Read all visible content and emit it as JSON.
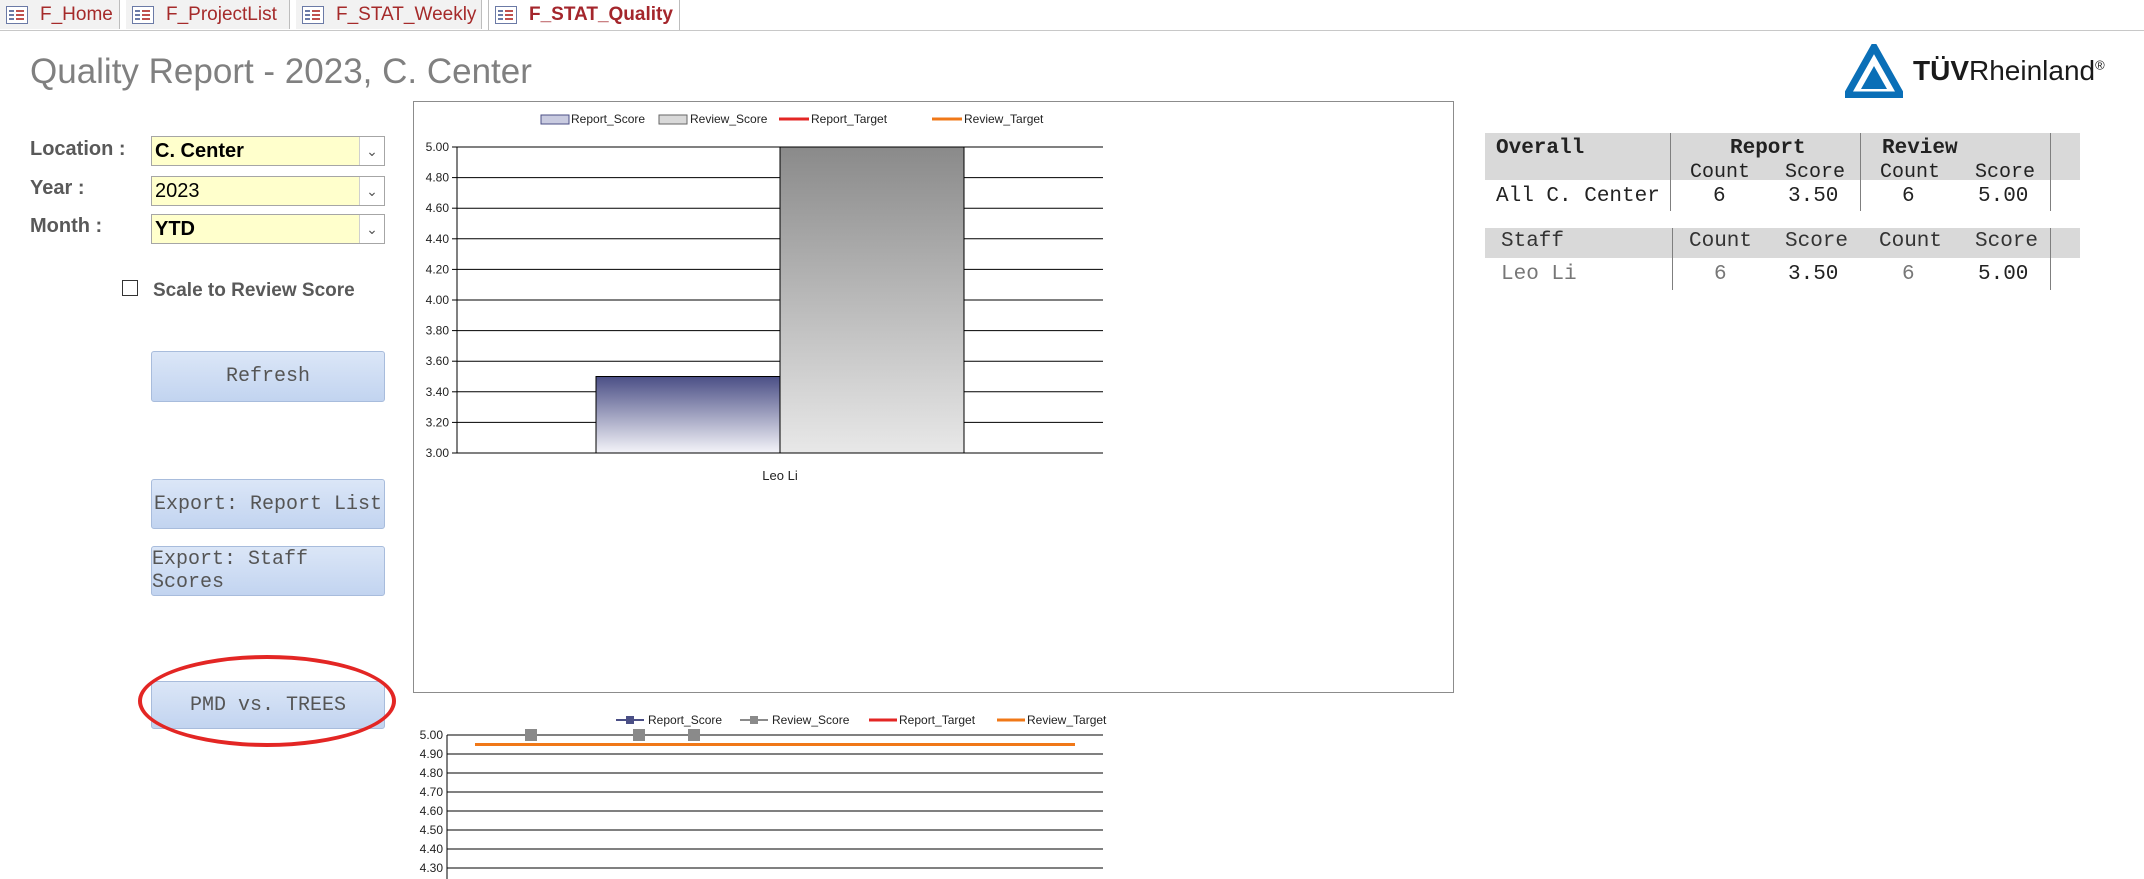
{
  "tabs": [
    {
      "label": "F_Home"
    },
    {
      "label": "F_ProjectList"
    },
    {
      "label": "F_STAT_Weekly"
    },
    {
      "label": "F_STAT_Quality",
      "active": true
    }
  ],
  "title": "Quality Report -  2023, C. Center",
  "logo": {
    "text_bold": "TÜV",
    "text_rest": "Rheinland",
    "reg": "®"
  },
  "filters": {
    "location": {
      "label": "Location :",
      "value": "C. Center"
    },
    "year": {
      "label": "Year :",
      "value": "2023"
    },
    "month": {
      "label": "Month :",
      "value": "YTD"
    }
  },
  "checkbox": {
    "label": "Scale to Review Score",
    "checked": false
  },
  "buttons": {
    "refresh": "Refresh",
    "export_report": "Export: Report List",
    "export_staff": "Export: Staff Scores",
    "pmd": "PMD vs. TREES"
  },
  "colors": {
    "report_score": "#4b4f86",
    "review_score": "#8a8a8a",
    "report_target": "#e32624",
    "review_target": "#f07818",
    "highlight": "#e32624"
  },
  "chart_data": [
    {
      "type": "bar",
      "categories": [
        "Leo Li"
      ],
      "series": [
        {
          "name": "Report_Score",
          "values": [
            3.5
          ]
        },
        {
          "name": "Review_Score",
          "values": [
            5.0
          ]
        }
      ],
      "legend": [
        "Report_Score",
        "Review_Score",
        "Report_Target",
        "Review_Target"
      ],
      "ylim": [
        3.0,
        5.0
      ],
      "yticks": [
        "5.00",
        "4.80",
        "4.60",
        "4.40",
        "4.20",
        "4.00",
        "3.80",
        "3.60",
        "3.40",
        "3.20",
        "3.00"
      ],
      "grid": true
    },
    {
      "type": "line",
      "legend": [
        "Report_Score",
        "Review_Score",
        "Report_Target",
        "Review_Target"
      ],
      "series": [
        {
          "name": "Review_Score",
          "values": [
            5.0,
            5.0,
            5.0
          ]
        },
        {
          "name": "Review_Target",
          "values": [
            4.95
          ]
        }
      ],
      "ylim": [
        4.3,
        5.0
      ],
      "yticks": [
        "5.00",
        "4.90",
        "4.80",
        "4.70",
        "4.60",
        "4.50",
        "4.40",
        "4.30"
      ],
      "grid": true
    }
  ],
  "overall_table": {
    "headers": {
      "col1": "Overall",
      "report": "Report",
      "review": "Review",
      "count": "Count",
      "score": "Score"
    },
    "row": {
      "name": "All C. Center",
      "report_count": "6",
      "report_score": "3.50",
      "review_count": "6",
      "review_score": "5.00"
    }
  },
  "staff_table": {
    "headers": {
      "col1": "Staff",
      "count": "Count",
      "score": "Score"
    },
    "rows": [
      {
        "name": "Leo Li",
        "report_count": "6",
        "report_score": "3.50",
        "review_count": "6",
        "review_score": "5.00"
      }
    ]
  }
}
